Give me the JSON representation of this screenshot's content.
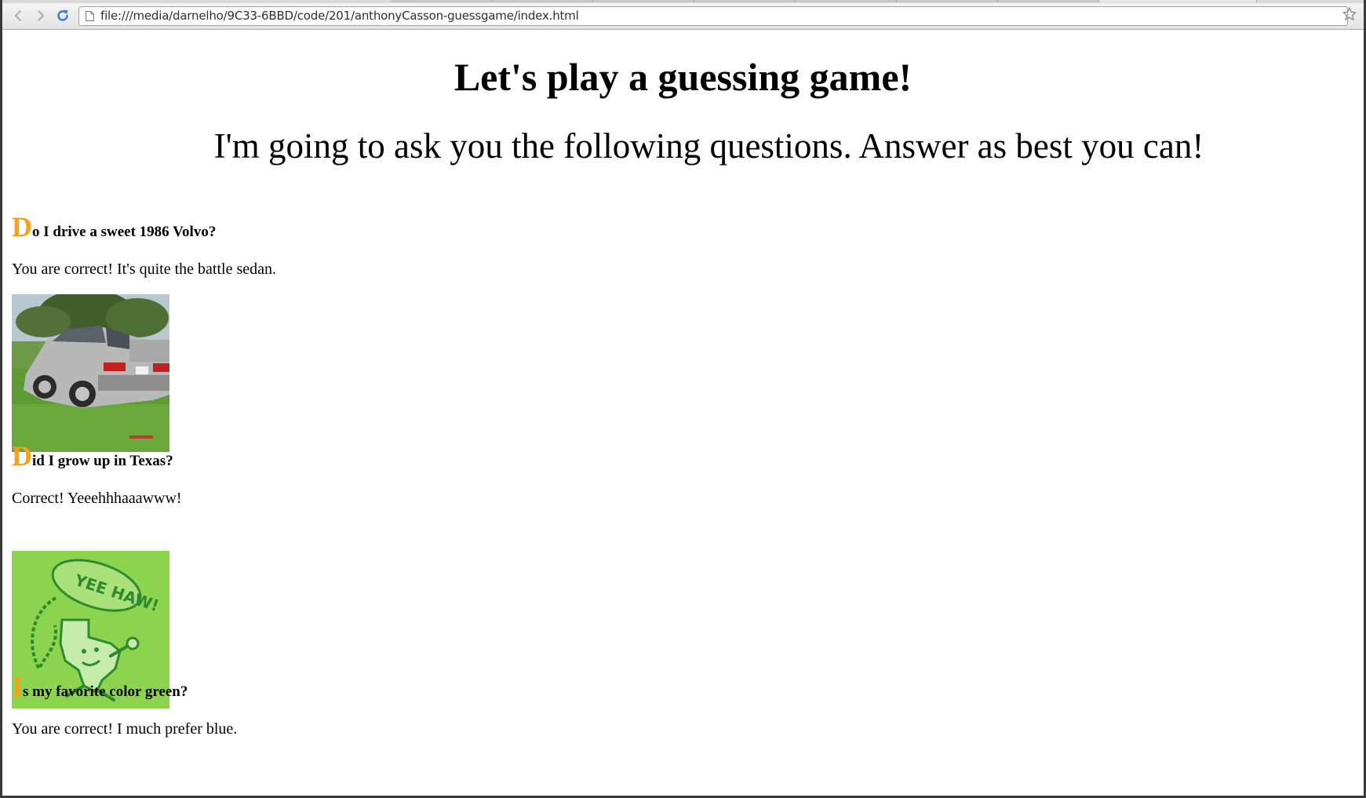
{
  "browser": {
    "url": "file:///media/darnelho/9C33-6BBD/code/201/anthonyCasson-guessgame/index.html",
    "icons": {
      "back": "back-arrow-icon",
      "forward": "forward-arrow-icon",
      "reload": "reload-icon",
      "page": "page-icon",
      "bookmark": "star-icon"
    }
  },
  "page": {
    "title": "Let's play a guessing game!",
    "subtitle": "I'm going to ask you the following questions. Answer as best you can!",
    "accent_color": "#f7a11a",
    "questions": [
      {
        "initial": "D",
        "rest": "o I drive a sweet 1986 Volvo?",
        "answer": "You are correct! It's quite the battle sedan.",
        "image": "silver-volvo-sedan"
      },
      {
        "initial": "D",
        "rest": "id I grow up in Texas?",
        "answer": "Correct! Yeeehhhaaawww!",
        "image": "texas-yee-haw-cartoon",
        "image_text": "YEE HAW!"
      },
      {
        "initial": "I",
        "rest": "s my favorite color green?",
        "answer": "You are correct! I much prefer blue."
      }
    ]
  }
}
